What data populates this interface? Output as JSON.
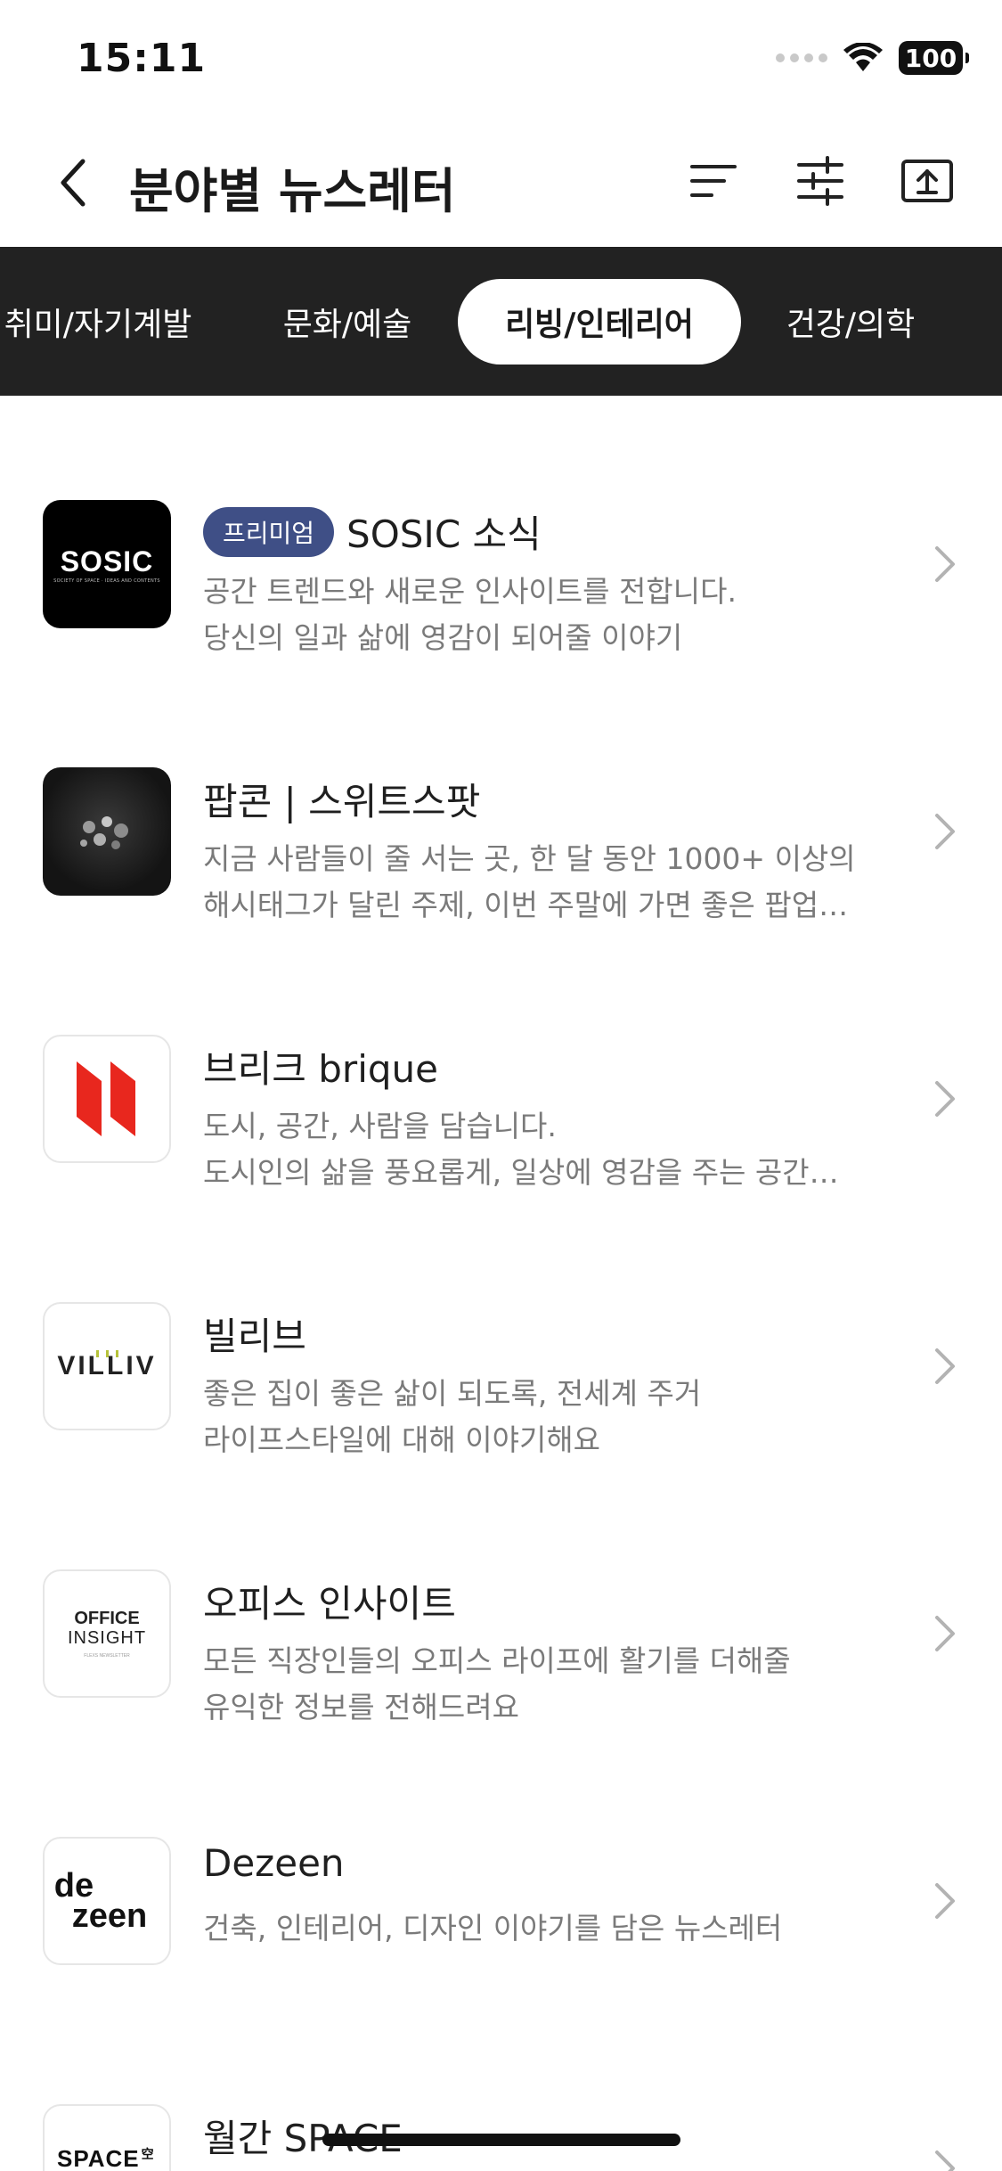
{
  "status_bar": {
    "time": "15:11",
    "battery": "100"
  },
  "header": {
    "title": "분야별 뉴스레터"
  },
  "tabs": [
    {
      "label": "취미/자기계발",
      "active": false
    },
    {
      "label": "문화/예술",
      "active": false
    },
    {
      "label": "리빙/인테리어",
      "active": true
    },
    {
      "label": "건강/의학",
      "active": false
    }
  ],
  "items": [
    {
      "badge": "프리미엄",
      "title": "SOSIC 소식",
      "logo_text": "SOSIC",
      "logo_sub": "SOCIETY OF SPACE · IDEAS AND CONTENTS",
      "desc": [
        "공간 트렌드와 새로운 인사이트를 전합니다.",
        "당신의 일과 삶에 영감이 되어줄 이야기"
      ]
    },
    {
      "title": "팝콘 | 스위트스팟",
      "desc": [
        "지금 사람들이 줄 서는 곳, 한 달 동안 1000+ 이상의",
        "해시태그가 달린 주제, 이번 주말에 가면 좋은 팝업…"
      ]
    },
    {
      "title": "브리크 brique",
      "desc": [
        "도시, 공간, 사람을 담습니다.",
        "도시인의 삶을 풍요롭게, 일상에 영감을 주는 공간…"
      ]
    },
    {
      "title": "빌리브",
      "logo_text": "VILLIV",
      "desc": [
        "좋은 집이 좋은 삶이 되도록, 전세계 주거",
        "라이프스타일에 대해 이야기해요"
      ]
    },
    {
      "title": "오피스 인사이트",
      "logo_text_1": "OFFICE",
      "logo_text_2": "INSIGHT",
      "logo_sub": "FLEXS NEWSLETTER",
      "desc": [
        "모든 직장인들의 오피스 라이프에 활기를 더해줄",
        "유익한 정보를 전해드려요"
      ]
    },
    {
      "title": "Dezeen",
      "logo_text_1": "de",
      "logo_text_2": "zeen",
      "desc": [
        "건축, 인테리어, 디자인 이야기를 담은 뉴스레터"
      ]
    },
    {
      "title": "월간 SPACE",
      "logo_text": "SPACE",
      "logo_mark": "空",
      "desc": []
    }
  ]
}
